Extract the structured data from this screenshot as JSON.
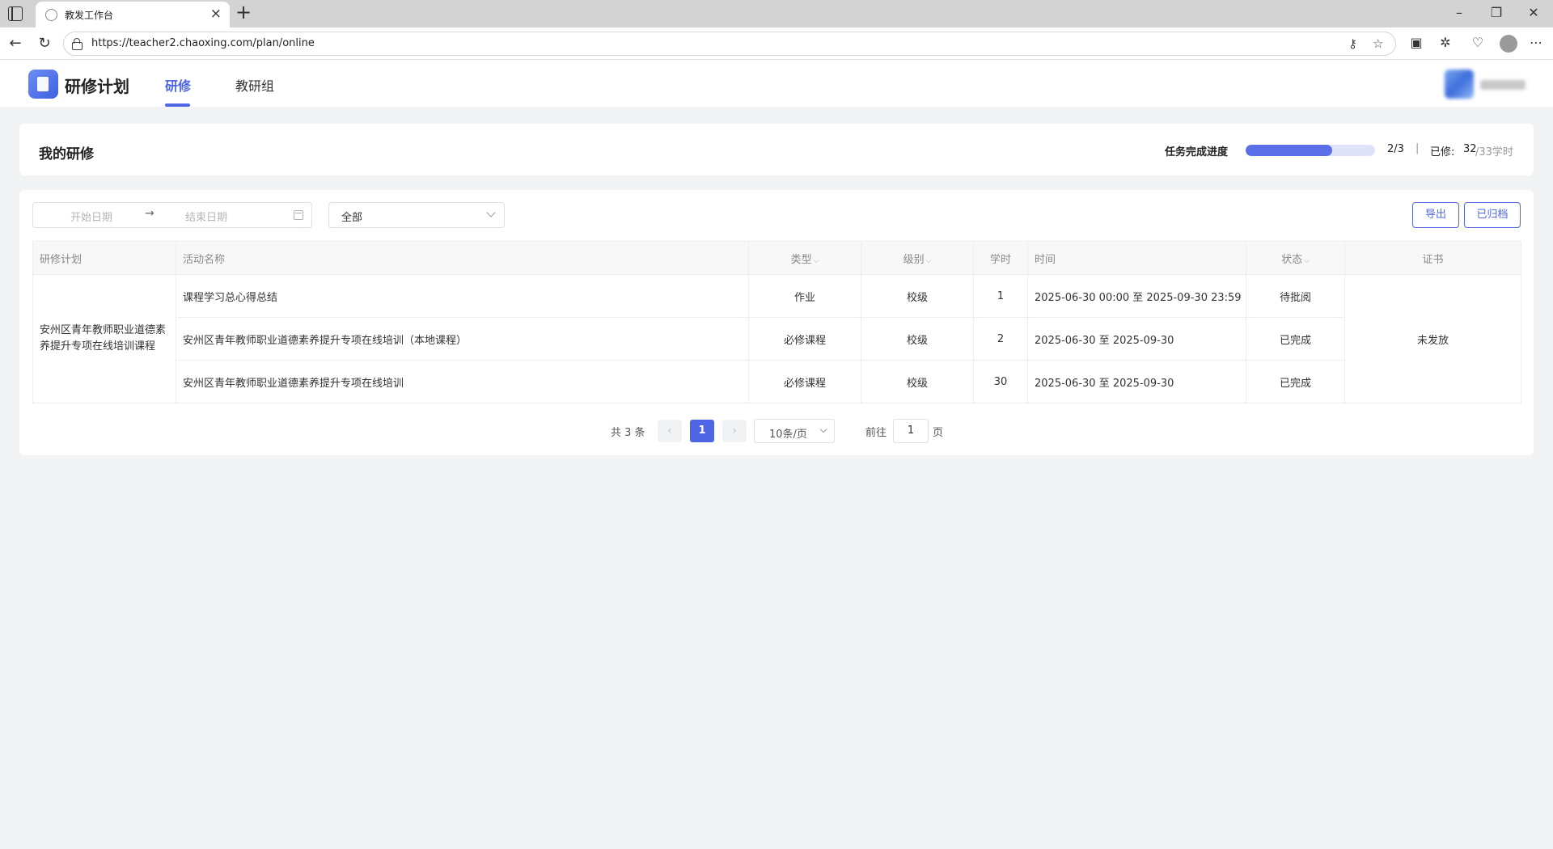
{
  "browser": {
    "tab_title": "教发工作台",
    "url": "https://teacher2.chaoxing.com/plan/online",
    "icons": [
      "sidebar-toggle-icon",
      "globe-icon",
      "close-icon",
      "plus-icon",
      "minimize-icon",
      "restore-icon",
      "back-icon",
      "reload-icon",
      "lock-icon",
      "key-icon",
      "star-icon",
      "collections-icon",
      "extensions-icon",
      "health-icon",
      "profile-icon",
      "more-icon"
    ]
  },
  "header": {
    "app_title": "研修计划",
    "nav": [
      {
        "label": "研修",
        "active": true
      },
      {
        "label": "教研组",
        "active": false
      }
    ]
  },
  "progress": {
    "title": "我的研修",
    "label": "任务完成进度",
    "fraction": 0.6667,
    "count": "2/3",
    "separator": "|",
    "done_label": "已修:",
    "done_value": "32",
    "done_total": "/33学时",
    "accent": "#5a6ee8"
  },
  "filters": {
    "start_placeholder": "开始日期",
    "arrow": "→",
    "end_placeholder": "结束日期",
    "select_value": "全部",
    "export_label": "导出",
    "archived_label": "已归档"
  },
  "table": {
    "headers": [
      "研修计划",
      "活动名称",
      "类型",
      "级别",
      "学时",
      "时间",
      "状态",
      "证书"
    ],
    "sort_glyph": "⌵",
    "plan_name": "安州区青年教师职业道德素养提升专项在线培训课程",
    "certificate": "未发放",
    "rows": [
      {
        "activity": "课程学习总心得总结",
        "type": "作业",
        "level": "校级",
        "hours": "1",
        "time": "2025-06-30 00:00 至 2025-09-30 23:59",
        "status": "待批阅"
      },
      {
        "activity": "安州区青年教师职业道德素养提升专项在线培训（本地课程）",
        "type": "必修课程",
        "level": "校级",
        "hours": "2",
        "time": "2025-06-30 至 2025-09-30",
        "status": "已完成"
      },
      {
        "activity": "安州区青年教师职业道德素养提升专项在线培训",
        "type": "必修课程",
        "level": "校级",
        "hours": "30",
        "time": "2025-06-30 至 2025-09-30",
        "status": "已完成"
      }
    ]
  },
  "pagination": {
    "total": "共 3 条",
    "prev": "‹",
    "current": "1",
    "next": "›",
    "page_size": "10条/页",
    "goto_label": "前往",
    "goto_value": "1",
    "page_suffix": "页"
  },
  "colors": {
    "accent": "#4e66e6",
    "page_bg": "#f2f3f5"
  }
}
